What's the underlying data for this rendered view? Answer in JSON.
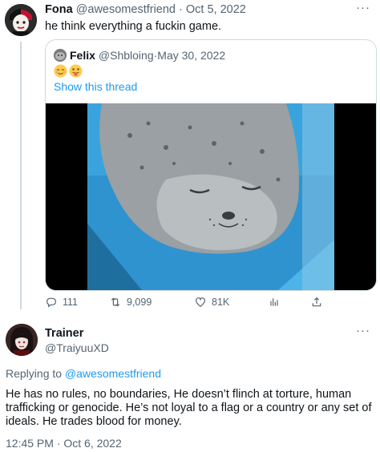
{
  "tweet": {
    "author_name": "Fona",
    "handle": "@awesomestfriend",
    "separator": " · ",
    "date": "Oct 5, 2022",
    "more_label": "···",
    "text": "he think everything a fuckin game."
  },
  "quoted": {
    "author_name": "Felix",
    "handle": "@Shbloing",
    "separator": " · ",
    "date": "May 30, 2022",
    "emojis": [
      "relieved-face",
      "face-with-tongue"
    ],
    "show_thread_label": "Show this thread"
  },
  "actions": {
    "replies": "111",
    "retweets": "9,099",
    "likes": "81K"
  },
  "reply_tweet": {
    "author_name": "Trainer",
    "handle": "@TraiyuuXD",
    "more_label": "···",
    "replying_prefix": "Replying to ",
    "replying_to": "@awesomestfriend",
    "text": "He has no rules, no boundaries, He doesn’t flinch at torture, human trafficking or genocide. He’s not loyal to a flag or a country or any set of ideals. He trades blood for money.",
    "timestamp": "12:45 PM · Oct 6, 2022"
  },
  "colors": {
    "accent": "#1d9bf0",
    "muted": "#536471",
    "border": "#cfd9de"
  }
}
